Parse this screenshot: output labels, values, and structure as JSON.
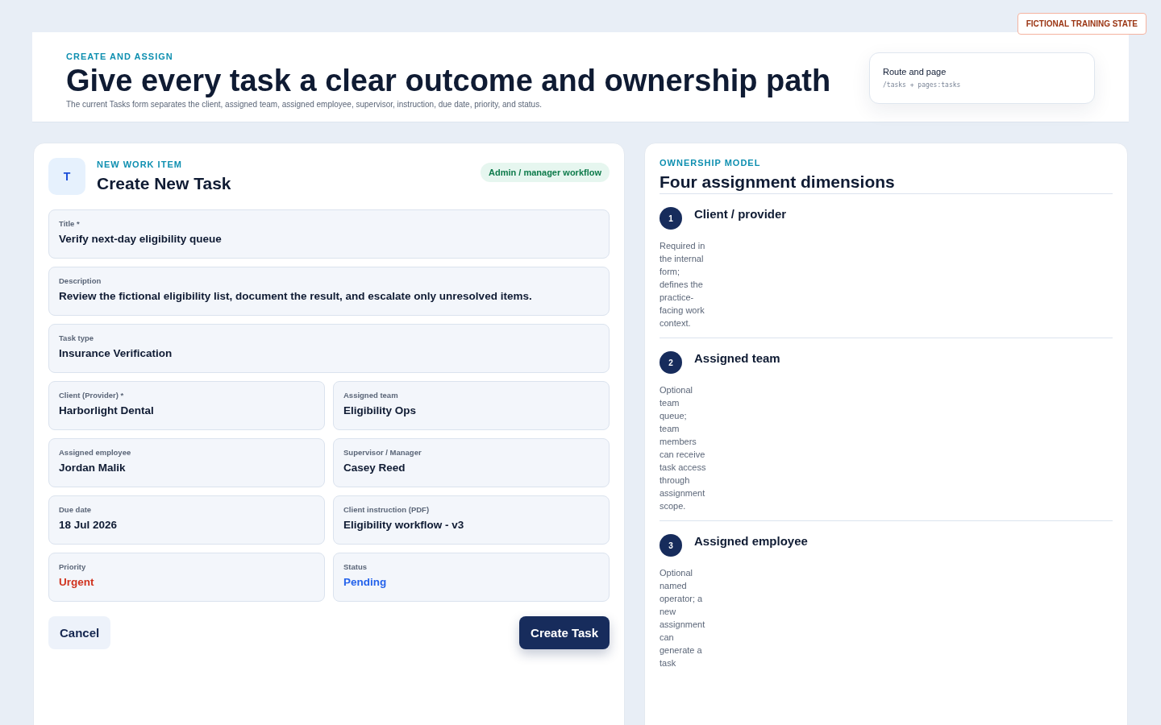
{
  "badge": "FICTIONAL TRAINING STATE",
  "header": {
    "eyebrow": "CREATE AND ASSIGN",
    "title": "Give every task a clear outcome and ownership path",
    "subtitle": "The current Tasks form separates the client, assigned team, assigned employee, supervisor, instruction, due date, priority, and status.",
    "route_card": {
      "title": "Route and page",
      "code": "/tasks + pages:tasks"
    }
  },
  "form": {
    "avatar": "T",
    "eyebrow": "NEW WORK ITEM",
    "title": "Create New Task",
    "pill": "Admin / manager workflow",
    "rows": [
      [
        {
          "label": "Title *",
          "value": "Verify next-day eligibility queue"
        }
      ],
      [
        {
          "label": "Description",
          "value": "Review the fictional eligibility list, document the result, and escalate only unresolved items."
        }
      ],
      [
        {
          "label": "Task type",
          "value": "Insurance Verification"
        }
      ],
      [
        {
          "label": "Client (Provider) *",
          "value": "Harborlight Dental"
        },
        {
          "label": "Assigned team",
          "value": "Eligibility Ops"
        }
      ],
      [
        {
          "label": "Assigned employee",
          "value": "Jordan Malik"
        },
        {
          "label": "Supervisor / Manager",
          "value": "Casey Reed"
        }
      ],
      [
        {
          "label": "Due date",
          "value": "18 Jul 2026"
        },
        {
          "label": "Client instruction (PDF)",
          "value": "Eligibility workflow - v3"
        }
      ],
      [
        {
          "label": "Priority",
          "value": "Urgent",
          "color": "#d0331f"
        },
        {
          "label": "Status",
          "value": "Pending",
          "color": "#2563eb"
        }
      ]
    ],
    "cancel": "Cancel",
    "submit": "Create Task"
  },
  "ownership": {
    "eyebrow": "OWNERSHIP MODEL",
    "title": "Four assignment dimensions",
    "items": [
      {
        "number": "1",
        "title": "Client / provider",
        "text": "Required in the internal form; defines the practice-facing work context."
      },
      {
        "number": "2",
        "title": "Assigned team",
        "text": "Optional team queue; team members can receive task access through assignment scope."
      },
      {
        "number": "3",
        "title": "Assigned employee",
        "text": "Optional named operator; a new assignment can generate a task"
      }
    ]
  }
}
